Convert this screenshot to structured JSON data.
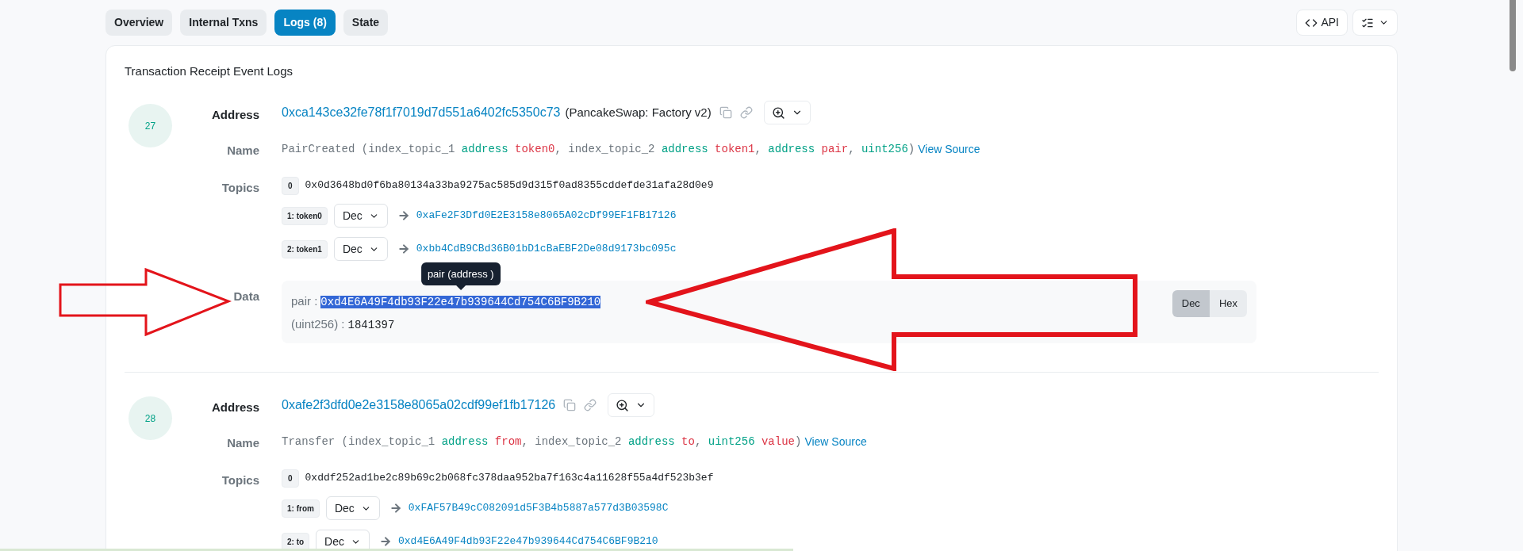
{
  "tabs": [
    {
      "label": "Overview",
      "selected": false
    },
    {
      "label": "Internal Txns",
      "selected": false
    },
    {
      "label": "Logs (8)",
      "selected": true
    },
    {
      "label": "State",
      "selected": false
    }
  ],
  "toolbar": {
    "api_button": "API"
  },
  "card": {
    "title": "Transaction Receipt Event Logs",
    "logs": [
      {
        "index": "27",
        "labels": {
          "address": "Address",
          "name": "Name",
          "topics": "Topics",
          "data": "Data"
        },
        "address": "0xca143ce32fe78f1f7019d7d551a6402fc5350c73",
        "address_tag": "(PancakeSwap: Factory v2)",
        "name_segments": [
          {
            "kind": "plain",
            "text": "PairCreated (index_topic_1 "
          },
          {
            "kind": "type",
            "text": "address"
          },
          {
            "kind": "param",
            "text": " token0"
          },
          {
            "kind": "plain",
            "text": ", index_topic_2 "
          },
          {
            "kind": "type",
            "text": "address"
          },
          {
            "kind": "param",
            "text": " token1"
          },
          {
            "kind": "plain",
            "text": ", "
          },
          {
            "kind": "type",
            "text": "address"
          },
          {
            "kind": "param",
            "text": " pair"
          },
          {
            "kind": "plain",
            "text": ", "
          },
          {
            "kind": "type",
            "text": "uint256"
          },
          {
            "kind": "plain",
            "text": ")"
          }
        ],
        "view_source": "View Source",
        "topics": [
          {
            "kind": "hash",
            "label": "0",
            "value": "0x0d3648bd0f6ba80134a33ba9275ac585d9d315f0ad8355cddefde31afa28d0e9"
          },
          {
            "kind": "decoded",
            "label": "1: token0",
            "format": "Dec",
            "value": "0xaFe2F3Dfd0E2E3158e8065A02cDf99EF1FB17126"
          },
          {
            "kind": "decoded",
            "label": "2: token1",
            "format": "Dec",
            "value": "0xbb4CdB9CBd36B01bD1cBaEBF2De08d9173bc095c"
          }
        ],
        "data": {
          "tooltip": "pair (address )",
          "rows": [
            {
              "label": "pair :",
              "value": "0xd4E6A49F4db93F22e47b939644Cd754C6BF9B210",
              "selected": true
            },
            {
              "label": "(uint256) :",
              "value": "1841397",
              "selected": false
            }
          ],
          "formats": [
            {
              "label": "Dec",
              "selected": true
            },
            {
              "label": "Hex",
              "selected": false
            }
          ]
        }
      },
      {
        "index": "28",
        "labels": {
          "address": "Address",
          "name": "Name",
          "topics": "Topics"
        },
        "address": "0xafe2f3dfd0e2e3158e8065a02cdf99ef1fb17126",
        "name_segments": [
          {
            "kind": "plain",
            "text": "Transfer (index_topic_1 "
          },
          {
            "kind": "type",
            "text": "address"
          },
          {
            "kind": "param",
            "text": " from"
          },
          {
            "kind": "plain",
            "text": ", index_topic_2 "
          },
          {
            "kind": "type",
            "text": "address"
          },
          {
            "kind": "param",
            "text": " to"
          },
          {
            "kind": "plain",
            "text": ", "
          },
          {
            "kind": "type",
            "text": "uint256"
          },
          {
            "kind": "param",
            "text": " value"
          },
          {
            "kind": "plain",
            "text": ")"
          }
        ],
        "view_source": "View Source",
        "topics": [
          {
            "kind": "hash",
            "label": "0",
            "value": "0xddf252ad1be2c89b69c2b068fc378daa952ba7f163c4a11628f55a4df523b3ef"
          },
          {
            "kind": "decoded",
            "label": "1: from",
            "format": "Dec",
            "value": "0xFAF57B49cC082091d5F3B4b5887a577d3B03598C"
          },
          {
            "kind": "decoded",
            "label": "2: to",
            "format": "Dec",
            "value": "0xd4E6A49F4db93F22e47b939644Cd754C6BF9B210"
          }
        ]
      }
    ]
  }
}
